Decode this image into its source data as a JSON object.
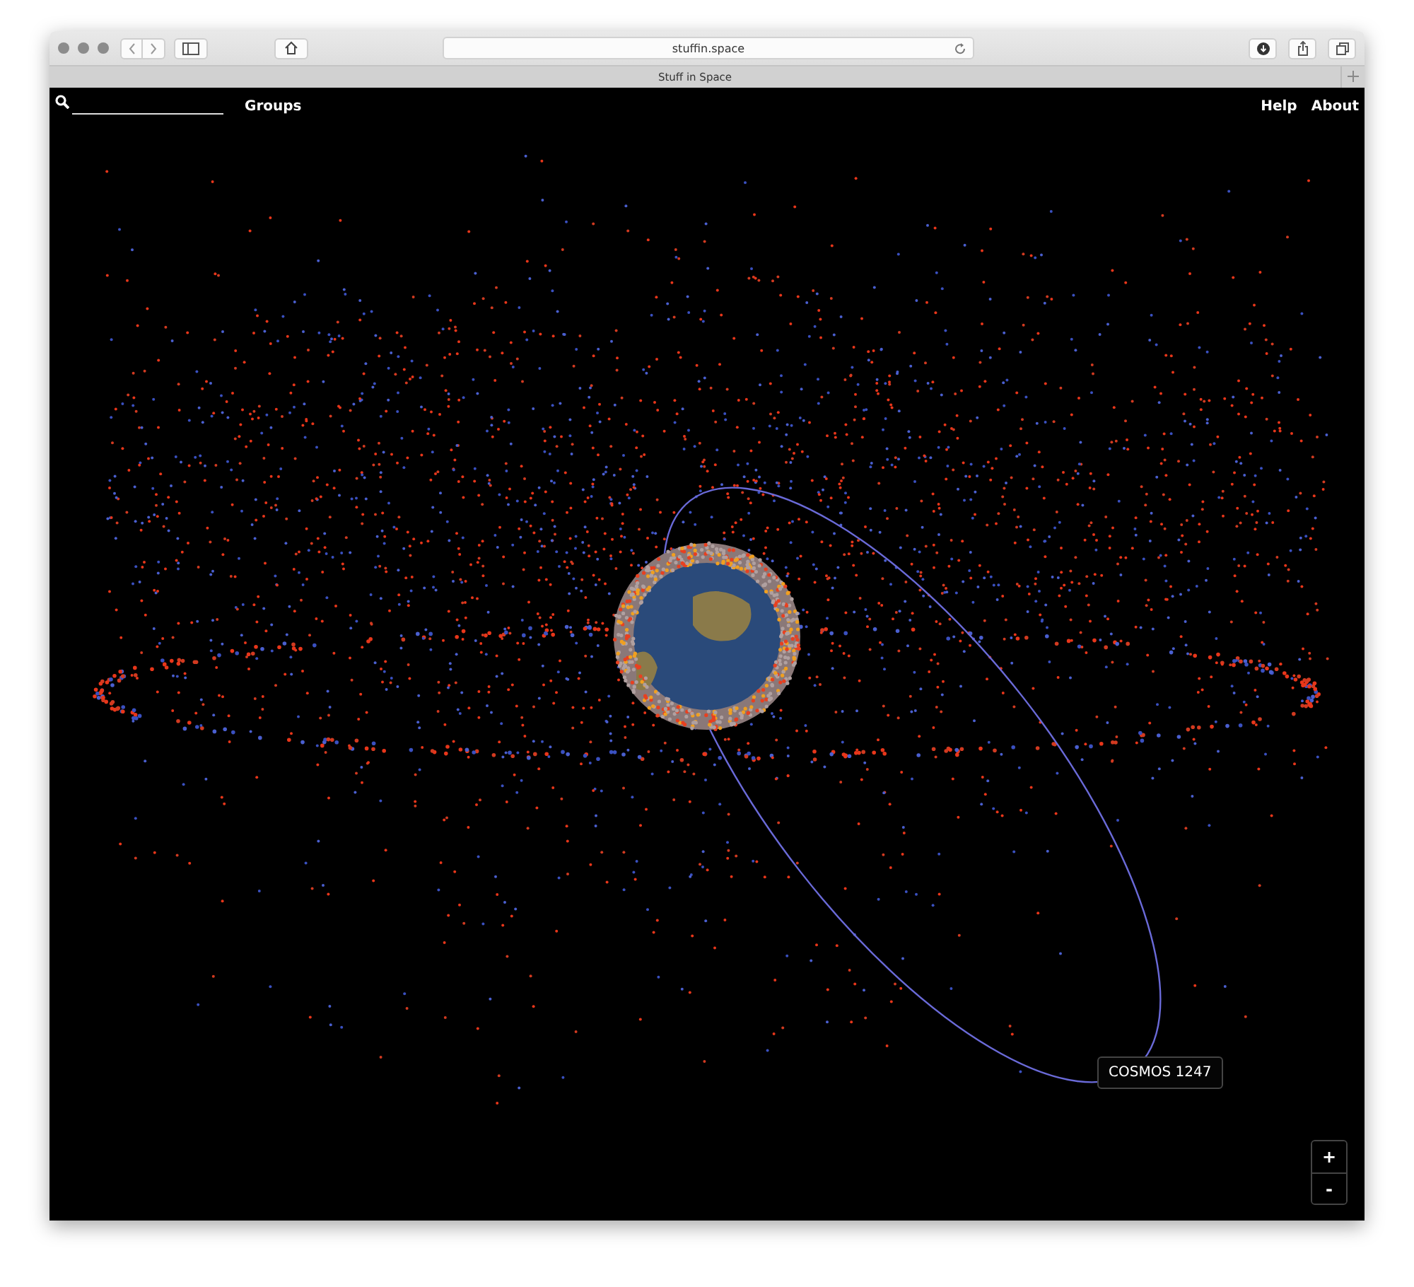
{
  "browser": {
    "address": "stuffin.space",
    "tab_title": "Stuff in Space"
  },
  "nav": {
    "left_links": [
      "Groups"
    ],
    "right_links": [
      "Help",
      "About"
    ]
  },
  "tooltip": "COSMOS 1247",
  "zoom_controls": [
    "+",
    "-"
  ]
}
